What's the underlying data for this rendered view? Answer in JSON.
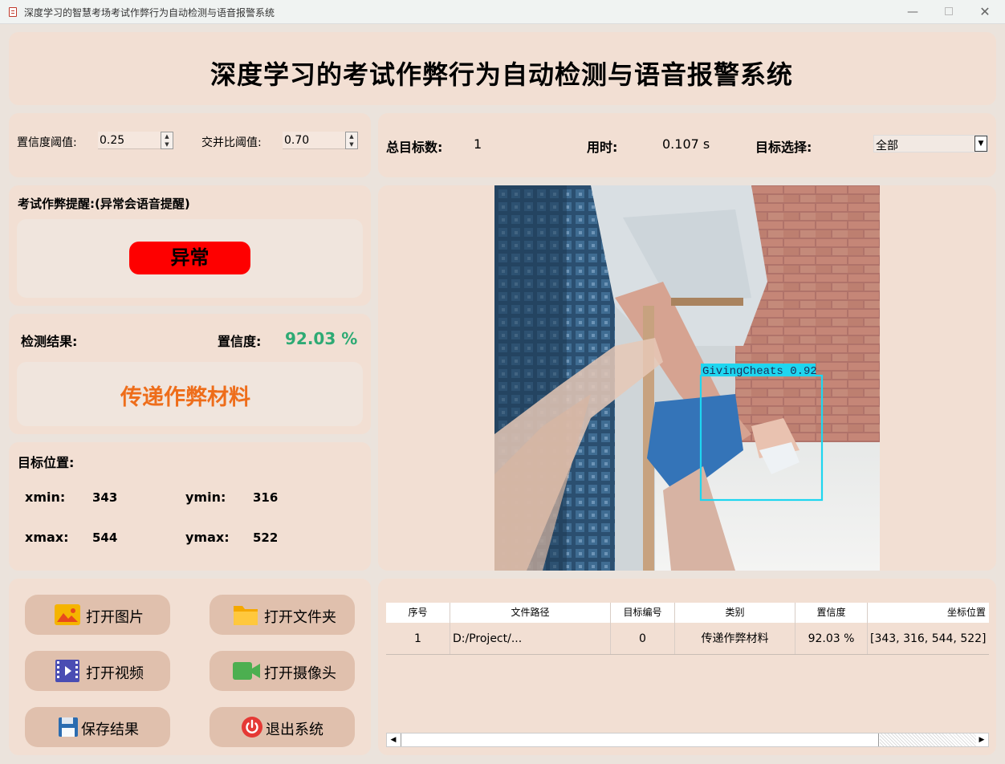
{
  "window": {
    "title": "深度学习的智慧考场考试作弊行为自动检测与语音报警系统",
    "minimize": "—",
    "close": "✕"
  },
  "header": {
    "title": "深度学习的考试作弊行为自动检测与语音报警系统"
  },
  "params": {
    "conf_label": "置信度阈值:",
    "conf_value": "0.25",
    "iou_label": "交并比阈值:",
    "iou_value": "0.70"
  },
  "stats": {
    "total_label": "总目标数:",
    "total_value": "1",
    "time_label": "用时:",
    "time_value": "0.107 s",
    "target_label": "目标选择:",
    "target_value": "全部"
  },
  "alert": {
    "label": "考试作弊提醒:(异常会语音提醒)",
    "status": "异常",
    "status_color": "#fe0000"
  },
  "result": {
    "label": "检测结果:",
    "confidence_label": "置信度:",
    "confidence_value": "92.03 %",
    "class_name": "传递作弊材料"
  },
  "position": {
    "label": "目标位置:",
    "xmin_label": "xmin:",
    "xmin": "343",
    "ymin_label": "ymin:",
    "ymin": "316",
    "xmax_label": "xmax:",
    "xmax": "544",
    "ymax_label": "ymax:",
    "ymax": "522"
  },
  "buttons": {
    "open_image": "打开图片",
    "open_folder": "打开文件夹",
    "open_video": "打开视频",
    "open_camera": "打开摄像头",
    "save_result": "保存结果",
    "exit": "退出系统"
  },
  "detection": {
    "box_label": "GivingCheats 0.92"
  },
  "table": {
    "headers": [
      "序号",
      "文件路径",
      "目标编号",
      "类别",
      "置信度",
      "坐标位置"
    ],
    "rows": [
      [
        "1",
        "D:/Project/...",
        "0",
        "传递作弊材料",
        "92.03 %",
        "[343, 316, 544, 522]"
      ]
    ]
  },
  "colors": {
    "panel_bg": "#f2dfd3",
    "accent_orange": "#ee6d1a",
    "accent_green": "#2eaa74",
    "box_cyan": "#1ed6f0"
  }
}
